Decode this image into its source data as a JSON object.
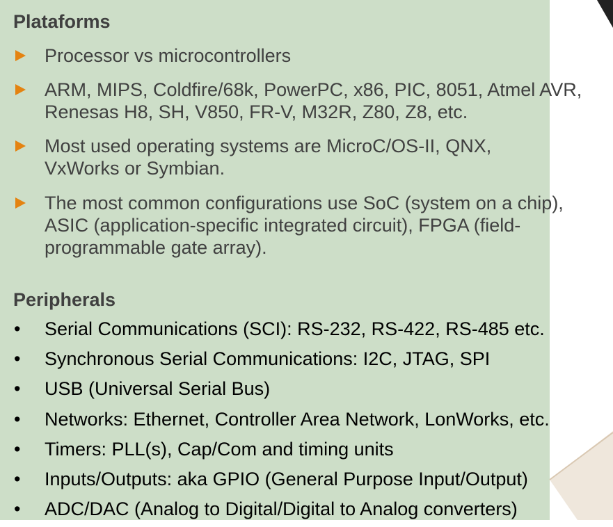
{
  "platforms": {
    "heading": "Plataforms",
    "items": [
      "Processor vs microcontrollers",
      "ARM, MIPS, Coldfire/68k, PowerPC, x86, PIC, 8051, Atmel AVR, Renesas H8, SH, V850, FR-V, M32R, Z80, Z8, etc.",
      "Most used operating systems are MicroC/OS-II, QNX, VxWorks or Symbian.",
      "The most common configurations use SoC (system on a chip), ASIC (application-specific integrated circuit), FPGA (field-programmable gate array)."
    ]
  },
  "peripherals": {
    "heading": "Peripherals",
    "bullet_symbol": "•",
    "items": [
      "Serial Communications (SCI): RS-232, RS-422, RS-485 etc.",
      "Synchronous Serial Communications: I2C, JTAG, SPI",
      "USB (Universal Serial Bus)",
      "Networks: Ethernet, Controller Area Network, LonWorks, etc.",
      "Timers: PLL(s), Cap/Com and timing units",
      "Inputs/Outputs: aka GPIO (General Purpose Input/Output)",
      "ADC/DAC (Analog to Digital/Digital to Analog converters)"
    ]
  },
  "colors": {
    "panel_background": "#cddec8",
    "arrow_bullet": "#e48311",
    "heading_text": "#404040",
    "body_text": "#000000",
    "decoration_dark": "#222222",
    "decoration_light": "#e8ddcf"
  }
}
